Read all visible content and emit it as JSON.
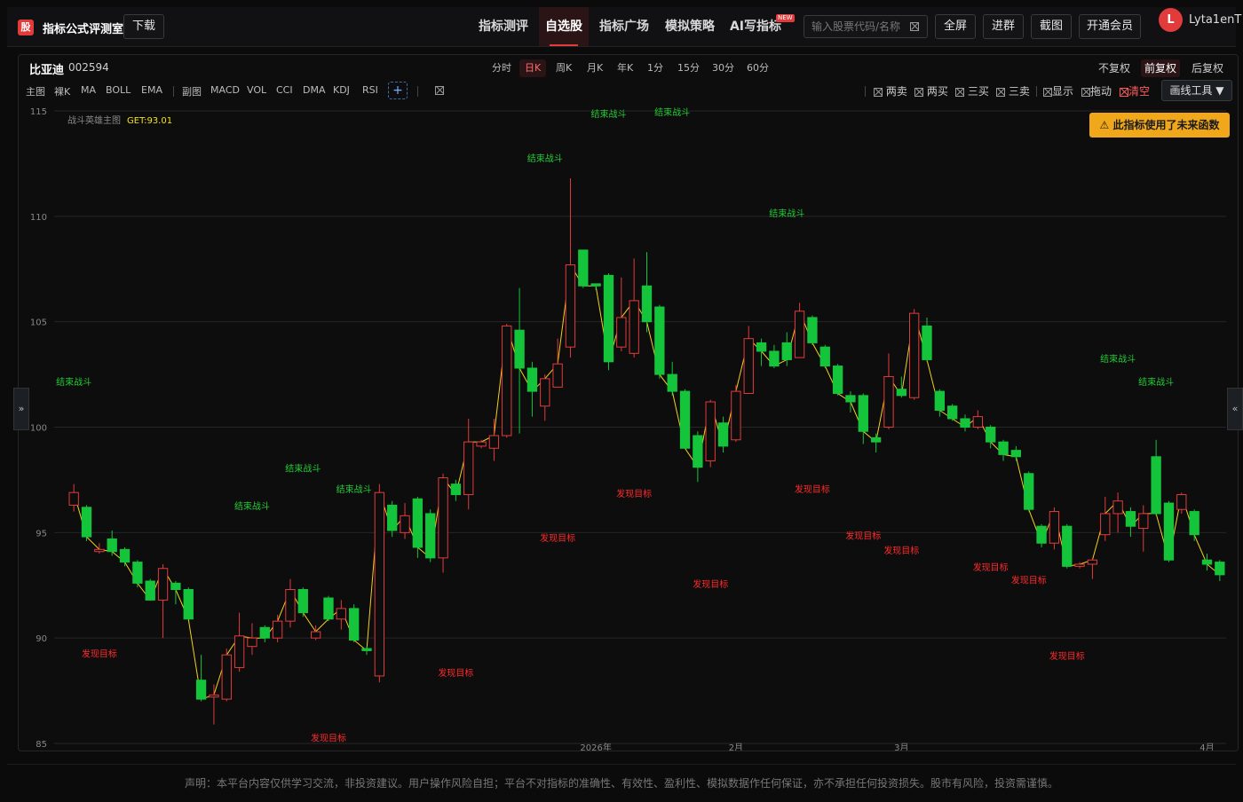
{
  "app": {
    "logo_char": "股",
    "title": "指标公式评测室",
    "download_label": "下载"
  },
  "nav": {
    "items": [
      {
        "label": "指标测评",
        "active": false
      },
      {
        "label": "自选股",
        "active": true
      },
      {
        "label": "指标广场",
        "active": false
      },
      {
        "label": "模拟策略",
        "active": false
      },
      {
        "label": "AI写指标",
        "active": false
      }
    ],
    "new_badge": "NEW"
  },
  "search": {
    "placeholder": "输入股票代码/名称",
    "value": ""
  },
  "header_buttons": {
    "fullscreen": "全屏",
    "join_group": "进群",
    "screenshot": "截图",
    "vip": "开通会员"
  },
  "user": {
    "avatar_letter": "L",
    "name": "Lyta1enT"
  },
  "stock": {
    "name": "比亚迪",
    "code": "002594"
  },
  "periods": {
    "items": [
      "分时",
      "日K",
      "周K",
      "月K",
      "年K",
      "1分",
      "15分",
      "30分",
      "60分"
    ],
    "active": "日K"
  },
  "adjust": {
    "items": [
      "不复权",
      "前复权",
      "后复权"
    ],
    "active": "前复权"
  },
  "indicators": {
    "main_label": "主图",
    "main": [
      "裸K",
      "MA",
      "BOLL",
      "EMA"
    ],
    "sub_label": "副图",
    "sub": [
      "MACD",
      "VOL",
      "CCI",
      "DMA",
      "KDJ",
      "RSI"
    ],
    "add_symbol": "+"
  },
  "toggles": [
    "两卖",
    "两买",
    "三买",
    "三卖",
    "显示",
    "拖动",
    "清空"
  ],
  "draw_tools_label": "画线工具 ▼",
  "warning_label": "⚠ 此指标使用了未来函数",
  "side_handles": {
    "left": "»",
    "right": "«"
  },
  "legend": {
    "indicator_name": "战斗英雄主图",
    "get_text": "GET:93.01"
  },
  "colors": {
    "up": "#e23b3b",
    "down": "#14c43b",
    "signal_green": "#22cc33",
    "signal_red": "#ff2a2a",
    "line": "#f2d21b",
    "accent": "#e23b3b",
    "warning": "#f0a81a"
  },
  "chart_data": {
    "type": "candlestick",
    "ylim": [
      85,
      115
    ],
    "y_ticks": [
      85,
      90,
      95,
      100,
      105,
      110,
      115
    ],
    "x_labels": [
      {
        "label": "2026年",
        "index": 41
      },
      {
        "label": "2月",
        "index": 52
      },
      {
        "label": "3月",
        "index": 65
      },
      {
        "label": "4月",
        "index": 89
      }
    ],
    "candles": [
      {
        "o": 96.3,
        "c": 96.9,
        "h": 97.3,
        "l": 96.0
      },
      {
        "o": 96.2,
        "c": 94.8,
        "h": 96.3,
        "l": 94.6
      },
      {
        "o": 94.1,
        "c": 94.2,
        "h": 94.5,
        "l": 94.0
      },
      {
        "o": 94.7,
        "c": 94.1,
        "h": 95.1,
        "l": 93.9
      },
      {
        "o": 94.2,
        "c": 93.6,
        "h": 94.3,
        "l": 93.4
      },
      {
        "o": 93.6,
        "c": 92.6,
        "h": 93.7,
        "l": 92.4
      },
      {
        "o": 92.7,
        "c": 91.8,
        "h": 92.8,
        "l": 91.8
      },
      {
        "o": 91.8,
        "c": 93.3,
        "h": 93.5,
        "l": 90.0
      },
      {
        "o": 92.6,
        "c": 92.3,
        "h": 92.7,
        "l": 91.6
      },
      {
        "o": 92.3,
        "c": 90.9,
        "h": 92.4,
        "l": 90.9
      },
      {
        "o": 88.0,
        "c": 87.1,
        "h": 89.2,
        "l": 87.0
      },
      {
        "o": 87.2,
        "c": 87.3,
        "h": 87.8,
        "l": 85.9
      },
      {
        "o": 87.1,
        "c": 89.2,
        "h": 89.5,
        "l": 87.0
      },
      {
        "o": 88.6,
        "c": 90.1,
        "h": 91.2,
        "l": 88.4
      },
      {
        "o": 89.6,
        "c": 90.0,
        "h": 90.7,
        "l": 89.2
      },
      {
        "o": 90.5,
        "c": 90.0,
        "h": 90.6,
        "l": 89.8
      },
      {
        "o": 90.0,
        "c": 90.8,
        "h": 91.1,
        "l": 89.8
      },
      {
        "o": 90.8,
        "c": 92.3,
        "h": 92.8,
        "l": 90.5
      },
      {
        "o": 92.3,
        "c": 91.2,
        "h": 92.4,
        "l": 91.0
      },
      {
        "o": 90.0,
        "c": 90.3,
        "h": 90.6,
        "l": 89.9
      },
      {
        "o": 91.9,
        "c": 90.9,
        "h": 92.0,
        "l": 90.8
      },
      {
        "o": 90.9,
        "c": 91.4,
        "h": 91.8,
        "l": 90.4
      },
      {
        "o": 91.4,
        "c": 89.9,
        "h": 91.6,
        "l": 89.8
      },
      {
        "o": 89.5,
        "c": 89.4,
        "h": 89.6,
        "l": 89.2
      },
      {
        "o": 88.2,
        "c": 96.9,
        "h": 97.3,
        "l": 87.9
      },
      {
        "o": 96.3,
        "c": 95.1,
        "h": 96.5,
        "l": 94.8
      },
      {
        "o": 95.0,
        "c": 95.8,
        "h": 96.4,
        "l": 94.7
      },
      {
        "o": 96.6,
        "c": 94.3,
        "h": 96.7,
        "l": 93.8
      },
      {
        "o": 95.9,
        "c": 93.8,
        "h": 96.1,
        "l": 93.6
      },
      {
        "o": 93.8,
        "c": 97.6,
        "h": 97.8,
        "l": 93.1
      },
      {
        "o": 97.3,
        "c": 96.8,
        "h": 97.5,
        "l": 96.5
      },
      {
        "o": 96.8,
        "c": 99.3,
        "h": 100.4,
        "l": 96.1
      },
      {
        "o": 99.1,
        "c": 99.3,
        "h": 99.4,
        "l": 99.0
      },
      {
        "o": 99.0,
        "c": 99.6,
        "h": 100.4,
        "l": 98.4
      },
      {
        "o": 99.6,
        "c": 104.8,
        "h": 104.9,
        "l": 99.5
      },
      {
        "o": 104.6,
        "c": 102.8,
        "h": 106.6,
        "l": 99.7
      },
      {
        "o": 102.8,
        "c": 101.7,
        "h": 103.1,
        "l": 100.5
      },
      {
        "o": 101.0,
        "c": 102.3,
        "h": 102.5,
        "l": 100.3
      },
      {
        "o": 101.9,
        "c": 103.0,
        "h": 104.2,
        "l": 101.9
      },
      {
        "o": 103.8,
        "c": 107.7,
        "h": 111.8,
        "l": 103.3
      },
      {
        "o": 108.4,
        "c": 106.7,
        "h": 108.4,
        "l": 106.6
      },
      {
        "o": 106.8,
        "c": 106.7,
        "h": 106.8,
        "l": 106.5
      },
      {
        "o": 107.2,
        "c": 103.1,
        "h": 107.3,
        "l": 102.7
      },
      {
        "o": 103.8,
        "c": 105.2,
        "h": 107.1,
        "l": 103.6
      },
      {
        "o": 103.5,
        "c": 106.0,
        "h": 108.0,
        "l": 103.3
      },
      {
        "o": 106.7,
        "c": 105.0,
        "h": 108.3,
        "l": 104.5
      },
      {
        "o": 105.7,
        "c": 102.5,
        "h": 105.8,
        "l": 102.3
      },
      {
        "o": 102.5,
        "c": 101.7,
        "h": 103.1,
        "l": 101.5
      },
      {
        "o": 101.7,
        "c": 99.0,
        "h": 101.8,
        "l": 99.0
      },
      {
        "o": 99.6,
        "c": 98.1,
        "h": 99.8,
        "l": 97.4
      },
      {
        "o": 98.4,
        "c": 101.2,
        "h": 101.3,
        "l": 98.1
      },
      {
        "o": 100.2,
        "c": 99.1,
        "h": 100.5,
        "l": 98.8
      },
      {
        "o": 99.4,
        "c": 101.7,
        "h": 102.0,
        "l": 99.3
      },
      {
        "o": 101.6,
        "c": 104.2,
        "h": 104.8,
        "l": 101.6
      },
      {
        "o": 104.0,
        "c": 103.6,
        "h": 104.2,
        "l": 102.9
      },
      {
        "o": 103.6,
        "c": 102.9,
        "h": 103.9,
        "l": 102.8
      },
      {
        "o": 104.0,
        "c": 103.2,
        "h": 104.5,
        "l": 102.9
      },
      {
        "o": 103.3,
        "c": 105.5,
        "h": 105.9,
        "l": 103.3
      },
      {
        "o": 105.2,
        "c": 104.0,
        "h": 105.3,
        "l": 103.9
      },
      {
        "o": 103.8,
        "c": 102.9,
        "h": 103.9,
        "l": 102.8
      },
      {
        "o": 102.9,
        "c": 101.6,
        "h": 103.0,
        "l": 101.5
      },
      {
        "o": 101.5,
        "c": 101.2,
        "h": 101.7,
        "l": 100.7
      },
      {
        "o": 101.5,
        "c": 99.8,
        "h": 101.6,
        "l": 99.2
      },
      {
        "o": 99.5,
        "c": 99.3,
        "h": 99.7,
        "l": 98.8
      },
      {
        "o": 100.0,
        "c": 102.4,
        "h": 103.5,
        "l": 99.9
      },
      {
        "o": 101.8,
        "c": 101.5,
        "h": 102.4,
        "l": 101.4
      },
      {
        "o": 101.4,
        "c": 105.4,
        "h": 105.6,
        "l": 101.3
      },
      {
        "o": 104.8,
        "c": 103.2,
        "h": 105.2,
        "l": 103.1
      },
      {
        "o": 101.7,
        "c": 100.8,
        "h": 101.8,
        "l": 100.5
      },
      {
        "o": 101.0,
        "c": 100.4,
        "h": 101.1,
        "l": 100.3
      },
      {
        "o": 100.4,
        "c": 100.0,
        "h": 100.6,
        "l": 99.8
      },
      {
        "o": 100.0,
        "c": 100.5,
        "h": 100.8,
        "l": 99.9
      },
      {
        "o": 100.0,
        "c": 99.3,
        "h": 100.1,
        "l": 99.0
      },
      {
        "o": 99.3,
        "c": 98.7,
        "h": 99.4,
        "l": 98.4
      },
      {
        "o": 98.9,
        "c": 98.6,
        "h": 99.1,
        "l": 98.4
      },
      {
        "o": 97.8,
        "c": 96.1,
        "h": 97.9,
        "l": 96.0
      },
      {
        "o": 95.3,
        "c": 94.5,
        "h": 95.4,
        "l": 94.3
      },
      {
        "o": 94.5,
        "c": 96.0,
        "h": 96.2,
        "l": 94.2
      },
      {
        "o": 95.3,
        "c": 93.4,
        "h": 95.4,
        "l": 93.3
      },
      {
        "o": 93.4,
        "c": 93.5,
        "h": 93.6,
        "l": 93.3
      },
      {
        "o": 93.5,
        "c": 93.7,
        "h": 93.8,
        "l": 92.8
      },
      {
        "o": 94.9,
        "c": 95.9,
        "h": 96.7,
        "l": 94.6
      },
      {
        "o": 95.9,
        "c": 96.5,
        "h": 96.9,
        "l": 95.0
      },
      {
        "o": 96.0,
        "c": 95.3,
        "h": 96.2,
        "l": 94.8
      },
      {
        "o": 95.2,
        "c": 95.9,
        "h": 96.3,
        "l": 94.1
      },
      {
        "o": 98.6,
        "c": 95.9,
        "h": 99.4,
        "l": 95.8
      },
      {
        "o": 96.4,
        "c": 93.7,
        "h": 96.5,
        "l": 93.6
      },
      {
        "o": 96.1,
        "c": 96.8,
        "h": 96.9,
        "l": 95.9
      },
      {
        "o": 96.0,
        "c": 94.9,
        "h": 96.1,
        "l": 94.6
      },
      {
        "o": 93.7,
        "c": 93.5,
        "h": 94.0,
        "l": 93.2
      },
      {
        "o": 93.6,
        "c": 93.0,
        "h": 93.7,
        "l": 92.7
      }
    ],
    "signals": [
      {
        "text": "结束战斗",
        "type": "green",
        "index": 0,
        "price": 102.0
      },
      {
        "text": "发现目标",
        "type": "red",
        "index": 2,
        "price": 89.1
      },
      {
        "text": "结束战斗",
        "type": "green",
        "index": 14,
        "price": 96.1
      },
      {
        "text": "发现目标",
        "type": "red",
        "index": 20,
        "price": 85.1
      },
      {
        "text": "结束战斗",
        "type": "green",
        "index": 18,
        "price": 97.9
      },
      {
        "text": "结束战斗",
        "type": "green",
        "index": 22,
        "price": 96.9
      },
      {
        "text": "发现目标",
        "type": "red",
        "index": 30,
        "price": 88.2
      },
      {
        "text": "结束战斗",
        "type": "green",
        "index": 37,
        "price": 112.6
      },
      {
        "text": "发现目标",
        "type": "red",
        "index": 38,
        "price": 94.6
      },
      {
        "text": "结束战斗",
        "type": "green",
        "index": 42,
        "price": 114.7
      },
      {
        "text": "结束战斗",
        "type": "green",
        "index": 47,
        "price": 114.8
      },
      {
        "text": "发现目标",
        "type": "red",
        "index": 44,
        "price": 96.7
      },
      {
        "text": "发现目标",
        "type": "red",
        "index": 50,
        "price": 92.4
      },
      {
        "text": "结束战斗",
        "type": "green",
        "index": 56,
        "price": 110.0
      },
      {
        "text": "发现目标",
        "type": "red",
        "index": 58,
        "price": 96.9
      },
      {
        "text": "发现目标",
        "type": "red",
        "index": 62,
        "price": 94.7
      },
      {
        "text": "发现目标",
        "type": "red",
        "index": 65,
        "price": 94.0
      },
      {
        "text": "发现目标",
        "type": "red",
        "index": 72,
        "price": 93.2
      },
      {
        "text": "发现目标",
        "type": "red",
        "index": 75,
        "price": 92.6
      },
      {
        "text": "发现目标",
        "type": "red",
        "index": 78,
        "price": 89.0
      },
      {
        "text": "结束战斗",
        "type": "green",
        "index": 82,
        "price": 103.1
      },
      {
        "text": "结束战斗",
        "type": "green",
        "index": 85,
        "price": 102.0
      }
    ]
  },
  "footer": {
    "disclaimer": "声明：本平台内容仅供学习交流，非投资建议。用户操作风险自担；平台不对指标的准确性、有效性、盈利性、模拟数据作任何保证，亦不承担任何投资损失。股市有风险，投资需谨慎。"
  }
}
